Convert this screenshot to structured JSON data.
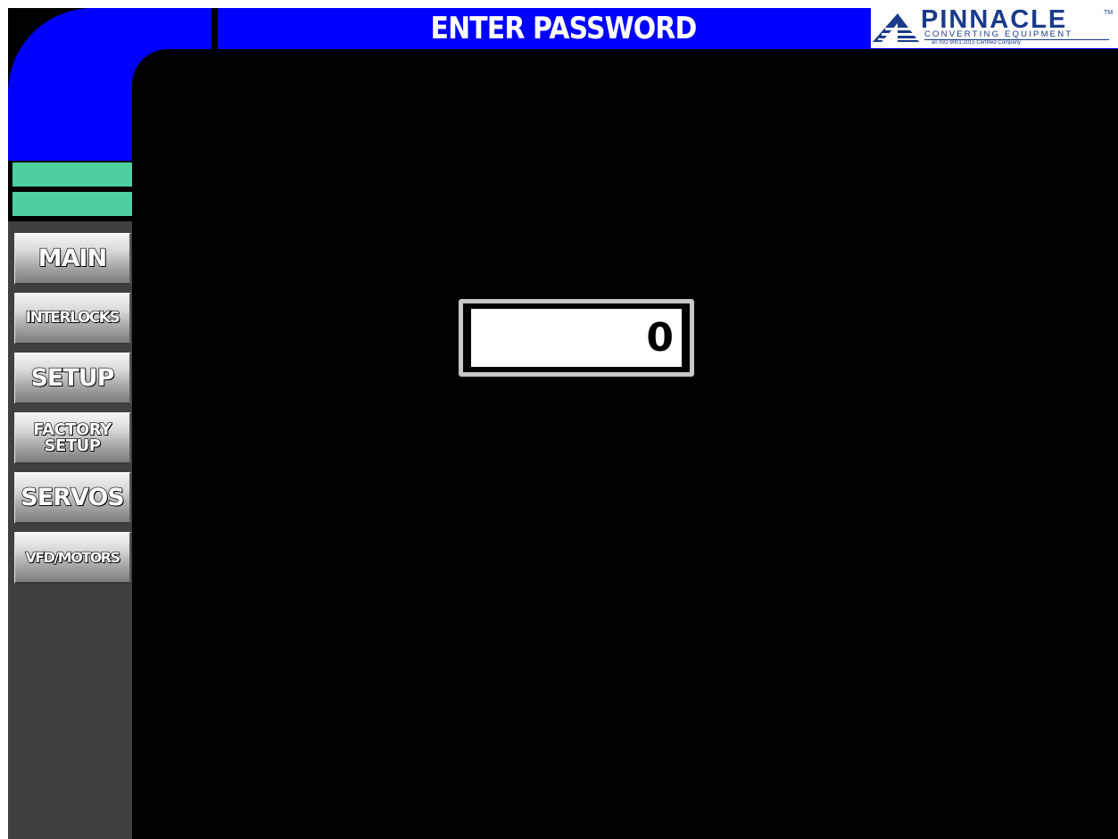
{
  "header": {
    "title": "ENTER PASSWORD"
  },
  "logo": {
    "name": "PINNACLE",
    "trademark": "TM",
    "subtitle": "CONVERTING EQUIPMENT",
    "certification": "an ISO 9001:2015 Certified Company",
    "icon": "pinnacle-mountain-logo"
  },
  "sidebar": {
    "items": [
      {
        "label": "MAIN"
      },
      {
        "label": "INTERLOCKS"
      },
      {
        "label": "SETUP"
      },
      {
        "label": "FACTORY\nSETUP"
      },
      {
        "label": "SERVOS"
      },
      {
        "label": "VFD/MOTORS"
      }
    ]
  },
  "password": {
    "value": "0"
  },
  "colors": {
    "frame_blue": "#0000ff",
    "accent_green": "#4dcfa0",
    "sidebar_gray": "#404040",
    "background": "#000000",
    "logo_blue": "#1a3a8a"
  }
}
